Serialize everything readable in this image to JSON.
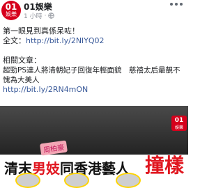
{
  "post": {
    "page_name": "01娛樂",
    "avatar_num": "01",
    "avatar_name": "娛樂",
    "time": "1 小時",
    "line1": "第一眼見到真係呆咗！",
    "line2_label": "全文：",
    "line2_link": "http://bit.ly/2NlYQ02",
    "related_label": "相關文章：",
    "related_text": "超勁PS達人將清朝妃子回復年輕面貌　慈禧太后最靚不愧為大美人",
    "related_link": "http://bit.ly/2RN4mON"
  },
  "image": {
    "brand_num": "01",
    "brand_name": "娛樂",
    "tag": "周柏豪",
    "headline_part1": "清末",
    "headline_part2": "男妓",
    "headline_part3": "同香港藝人",
    "headline_big": "撞樣"
  },
  "colors": {
    "brand_red": "#d6001c",
    "link_blue": "#385898",
    "headline_red": "#e0161f"
  }
}
